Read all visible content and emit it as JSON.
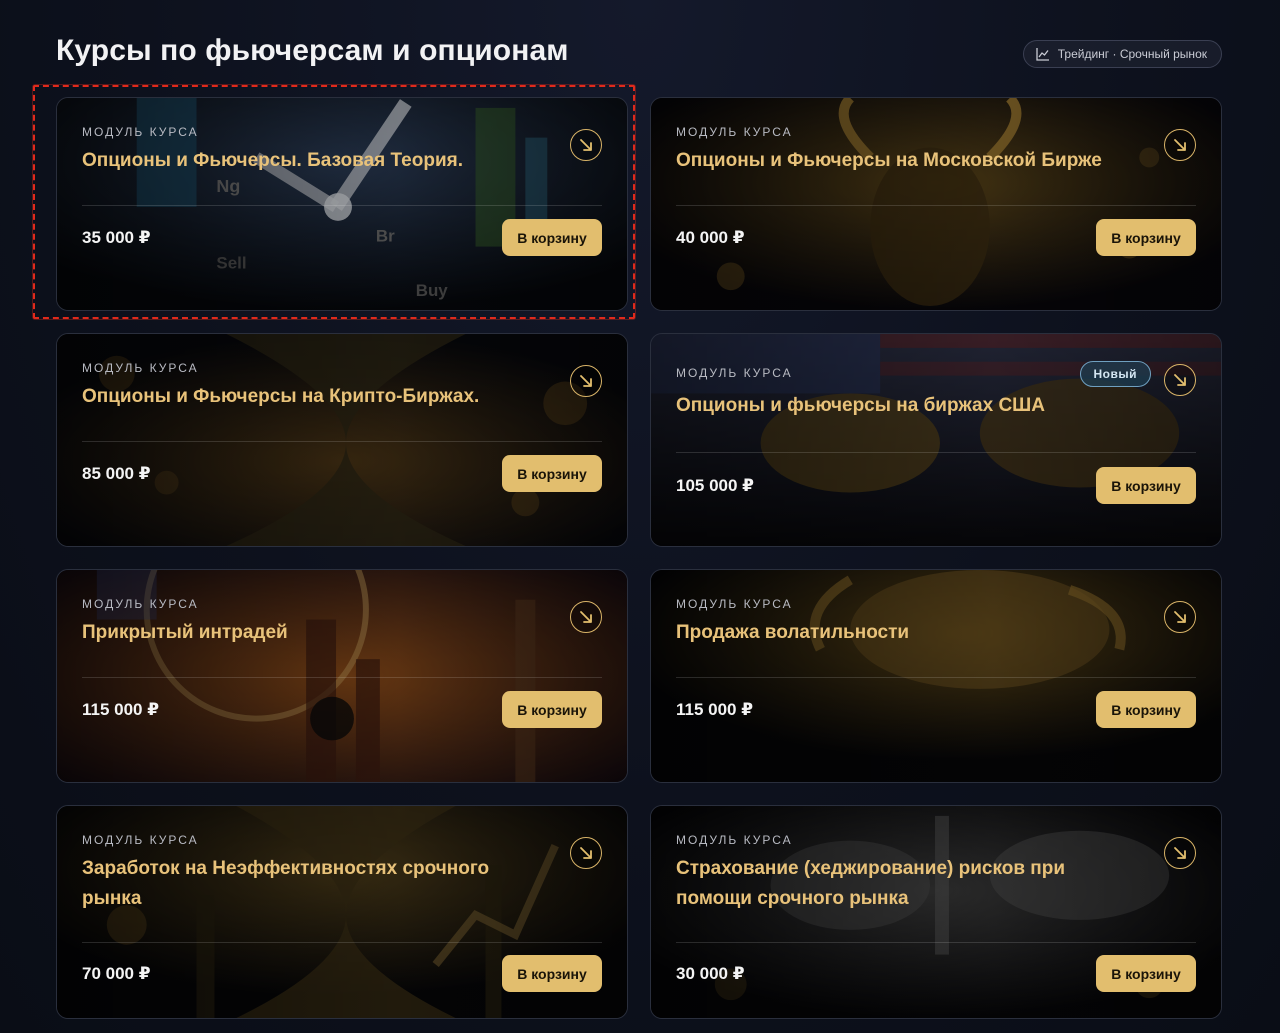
{
  "page": {
    "title": "Курсы по фьючерсам и опционам",
    "tag_chip": {
      "icon": "line-chart-icon",
      "label": "Трейдинг · Срочный рынок"
    }
  },
  "colors": {
    "accent_gold": "#e2be6e",
    "title_gold": "#e8c27a",
    "highlight_red": "#e02a1c",
    "badge_blue": "#6fa0c0"
  },
  "cards": [
    {
      "module_label": "МОДУЛЬ КУРСА",
      "title": "Опционы и Фьючерсы. Базовая Теория.",
      "price": "35 000 ₽",
      "cart_label": "В корзину",
      "badge": "",
      "theme": "clock"
    },
    {
      "module_label": "МОДУЛЬ КУРСА",
      "title": "Опционы и Фьючерсы на Московской Бирже",
      "price": "40 000 ₽",
      "cart_label": "В корзину",
      "badge": "",
      "theme": "bull"
    },
    {
      "module_label": "МОДУЛЬ КУРСА",
      "title": "Опционы и Фьючерсы на Крипто-Биржах.",
      "price": "85 000 ₽",
      "cart_label": "В корзину",
      "badge": "",
      "theme": "hourglass"
    },
    {
      "module_label": "МОДУЛЬ КУРСА",
      "title": "Опционы и фьючерсы на биржах США",
      "price": "105 000 ₽",
      "cart_label": "В корзину",
      "badge": "Новый",
      "theme": "usa"
    },
    {
      "module_label": "МОДУЛЬ КУРСА",
      "title": "Прикрытый интрадей",
      "price": "115 000 ₽",
      "cart_label": "В корзину",
      "badge": "",
      "theme": "city"
    },
    {
      "module_label": "МОДУЛЬ КУРСА",
      "title": "Продажа волатильности",
      "price": "115 000 ₽",
      "cart_label": "В корзину",
      "badge": "",
      "theme": "goldbull"
    },
    {
      "module_label": "МОДУЛЬ КУРСА",
      "title": "Заработок на Неэффективностях срочного рынка",
      "price": "70 000 ₽",
      "cart_label": "В корзину",
      "badge": "",
      "theme": "chart"
    },
    {
      "module_label": "МОДУЛЬ КУРСА",
      "title": "Страхование (хеджирование) рисков при помощи срочного рынка",
      "price": "30 000 ₽",
      "cart_label": "В корзину",
      "badge": "",
      "theme": "bears"
    }
  ],
  "card_arrow_icon": "arrow-down-right-icon",
  "highlight_note": "selected first card"
}
